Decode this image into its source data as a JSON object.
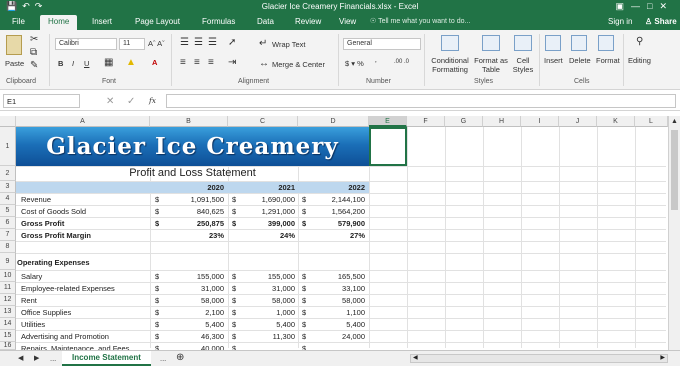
{
  "window": {
    "title": "Glacier Ice Creamery Financials.xlsx - Excel"
  },
  "tabs": [
    "File",
    "Home",
    "Insert",
    "Page Layout",
    "Formulas",
    "Data",
    "Review",
    "View"
  ],
  "tellme": "Tell me what you want to do...",
  "signin": "Sign in",
  "share": "Share",
  "ribbon": {
    "paste": "Paste",
    "font_name": "Calibri",
    "font_size": "11",
    "wrap_text": "Wrap Text",
    "merge_center": "Merge & Center",
    "number_format": "General",
    "cond_format": "Conditional Formatting",
    "format_table": "Format as Table",
    "cell_styles": "Cell Styles",
    "insert": "Insert",
    "delete": "Delete",
    "format": "Format",
    "editing": "Editing",
    "groups": [
      "Clipboard",
      "Font",
      "Alignment",
      "Number",
      "Styles",
      "Cells"
    ]
  },
  "namebox": "E1",
  "columns": [
    "A",
    "B",
    "C",
    "D",
    "E",
    "F",
    "G",
    "H",
    "I",
    "J",
    "K",
    "L"
  ],
  "rows": [
    "1",
    "2",
    "3",
    "4",
    "5",
    "6",
    "7",
    "8",
    "9",
    "10",
    "11",
    "12",
    "13",
    "14",
    "15",
    "16"
  ],
  "banner": "Glacier Ice Creamery",
  "sheet": {
    "subtitle": "Profit and Loss Statement",
    "years": [
      "2020",
      "2021",
      "2022"
    ],
    "lines": [
      {
        "label": "Revenue",
        "v": [
          "1,091,500",
          "1,690,000",
          "2,144,100"
        ],
        "cur": true,
        "bold": false
      },
      {
        "label": "Cost of Goods Sold",
        "v": [
          "840,625",
          "1,291,000",
          "1,564,200"
        ],
        "cur": true,
        "bold": false
      },
      {
        "label": "Gross Profit",
        "v": [
          "250,875",
          "399,000",
          "579,900"
        ],
        "cur": true,
        "bold": true
      },
      {
        "label": "Gross Profit Margin",
        "v": [
          "23%",
          "24%",
          "27%"
        ],
        "cur": false,
        "bold": true
      }
    ],
    "opex_title": "Operating Expenses",
    "opex": [
      {
        "label": "Salary",
        "v": [
          "155,000",
          "155,000",
          "165,500"
        ]
      },
      {
        "label": "Employee-related Expenses",
        "v": [
          "31,000",
          "31,000",
          "33,100"
        ]
      },
      {
        "label": "Rent",
        "v": [
          "58,000",
          "58,000",
          "58,000"
        ]
      },
      {
        "label": "Office Supplies",
        "v": [
          "2,100",
          "1,000",
          "1,100"
        ]
      },
      {
        "label": "Utilities",
        "v": [
          "5,400",
          "5,400",
          "5,400"
        ]
      },
      {
        "label": "Advertising and Promotion",
        "v": [
          "46,300",
          "11,300",
          "24,000"
        ]
      },
      {
        "label": "Repairs, Maintenance, and Fees",
        "v": [
          "40,000",
          "",
          ""
        ]
      }
    ],
    "dollar": "$"
  },
  "sheet_tab": "Income Statement"
}
